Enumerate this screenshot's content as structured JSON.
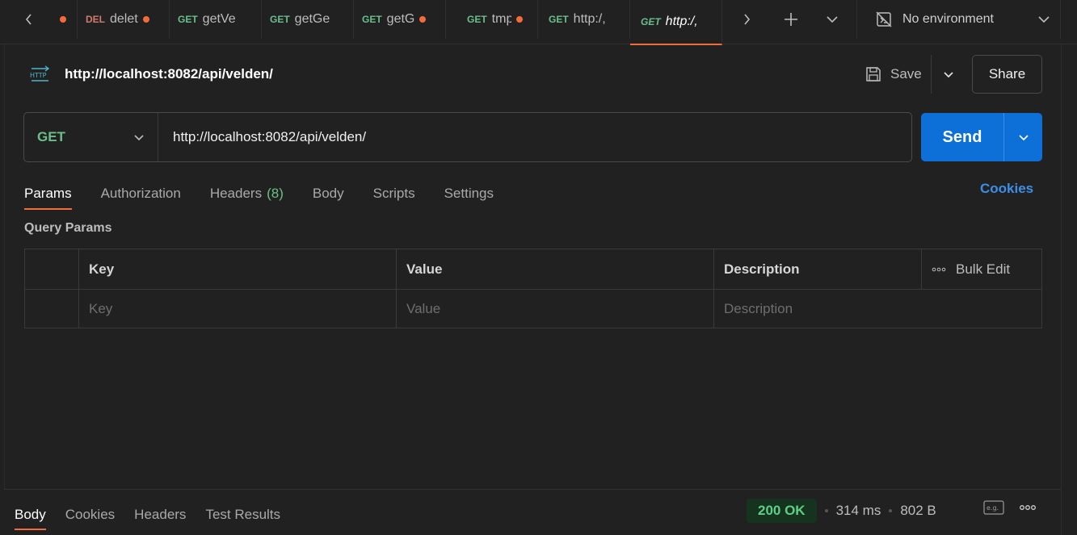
{
  "tabs": [
    {
      "method": "",
      "name": "",
      "unsaved": true
    },
    {
      "method": "DEL",
      "name": "delet",
      "unsaved": true
    },
    {
      "method": "GET",
      "name": "getVe",
      "unsaved": false
    },
    {
      "method": "GET",
      "name": "getGe",
      "unsaved": false
    },
    {
      "method": "GET",
      "name": "getG",
      "unsaved": true
    },
    {
      "method": "GET",
      "name": "tmp",
      "unsaved": true
    },
    {
      "method": "GET",
      "name": "http:/,",
      "unsaved": false
    },
    {
      "method": "GET",
      "name": "http:/,",
      "unsaved": false,
      "active": true
    }
  ],
  "environment": {
    "label": "No environment"
  },
  "request": {
    "title": "http://localhost:8082/api/velden/",
    "method": "GET",
    "url": "http://localhost:8082/api/velden/",
    "save_label": "Save",
    "share_label": "Share",
    "send_label": "Send",
    "http_icon_text": "HTTP"
  },
  "request_tabs": [
    {
      "label": "Params",
      "active": true
    },
    {
      "label": "Authorization"
    },
    {
      "label": "Headers",
      "count": "(8)"
    },
    {
      "label": "Body"
    },
    {
      "label": "Scripts"
    },
    {
      "label": "Settings"
    }
  ],
  "cookies_label": "Cookies",
  "query_params": {
    "section_label": "Query Params",
    "headers": {
      "key": "Key",
      "value": "Value",
      "description": "Description",
      "bulk_edit": "Bulk Edit"
    },
    "placeholders": {
      "key": "Key",
      "value": "Value",
      "description": "Description"
    }
  },
  "response": {
    "tabs": [
      "Body",
      "Cookies",
      "Headers",
      "Test Results"
    ],
    "status": "200 OK",
    "time": "314 ms",
    "size": "802 B",
    "example_icon_text": "e.g."
  },
  "colors": {
    "accent": "#f26b3a",
    "get": "#6bbf8a",
    "delete": "#d27a6b",
    "send": "#0d6fd8",
    "link": "#3b8fe8",
    "status_ok": "#5fcf85"
  }
}
